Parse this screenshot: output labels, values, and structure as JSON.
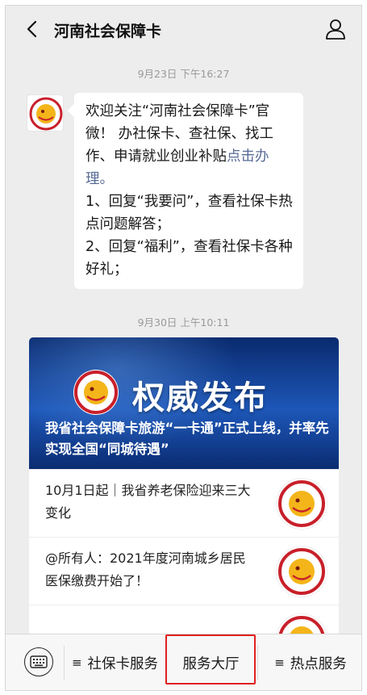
{
  "header": {
    "title": "河南社会保障卡",
    "back_icon": "chevron-left-icon",
    "profile_icon": "person-icon"
  },
  "messages": [
    {
      "timestamp": "9月23日 下午16:27",
      "welcome": {
        "para1_text": "欢迎关注“河南社会保障卡”官微！ 办社保卡、查社保、找工作、申请就业创业补贴",
        "para1_link": "点击办理。",
        "para2": "1、回复“我要问”，查看社保卡热点问题解答；",
        "para3": "2、回复“福利”，查看社保卡各种好礼；"
      }
    },
    {
      "timestamp": "9月30日 上午10:11",
      "article": {
        "banner_title": "权威发布",
        "headline": "我省社会保障卡旅游“一卡通”正式上线，并率先实现全国“同城待遇”",
        "items": [
          {
            "text": "10月1日起｜我省养老保险迎来三大变化"
          },
          {
            "text": "@所有人：2021年度河南城乡居民医保缴费开始了！"
          }
        ]
      }
    }
  ],
  "menu": {
    "keyboard_icon": "keyboard-icon",
    "items": [
      {
        "label": "社保卡服务"
      },
      {
        "label": "服务大厅"
      },
      {
        "label": "热点服务"
      }
    ],
    "hamburger": "≡"
  },
  "colors": {
    "background": "#ededed",
    "link": "#576b95",
    "banner": "#1d57b8",
    "highlight": "#e02020"
  }
}
